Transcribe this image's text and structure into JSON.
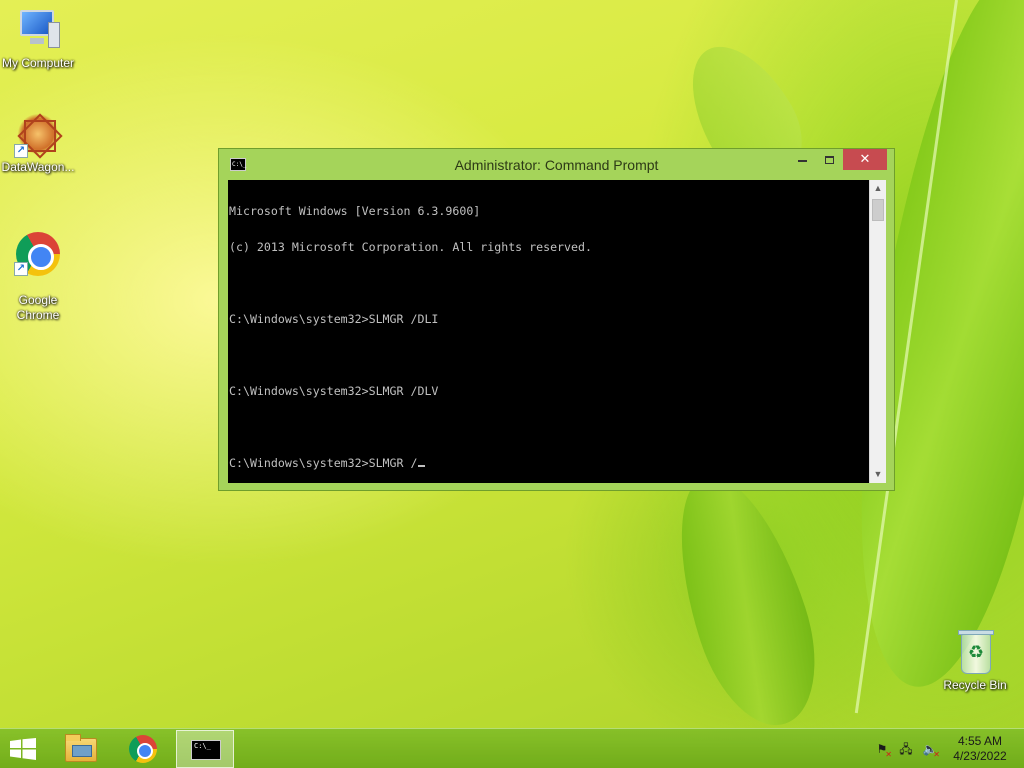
{
  "desktop": {
    "icons": [
      {
        "label": "My Computer",
        "icon": "computer-icon"
      },
      {
        "label": "DataWagon...",
        "icon": "datawagon-icon"
      },
      {
        "label": "Google\nChrome",
        "icon": "chrome-icon"
      },
      {
        "label": "Recycle Bin",
        "icon": "recycle-bin-icon"
      }
    ]
  },
  "window": {
    "title": "Administrator: Command Prompt",
    "close_glyph": "✕",
    "console_lines": [
      "Microsoft Windows [Version 6.3.9600]",
      "(c) 2013 Microsoft Corporation. All rights reserved.",
      "",
      "C:\\Windows\\system32>SLMGR /DLI",
      "",
      "C:\\Windows\\system32>SLMGR /DLV",
      "",
      "C:\\Windows\\system32>SLMGR /"
    ],
    "scroll_up_glyph": "▲",
    "scroll_down_glyph": "▼"
  },
  "taskbar": {
    "items": [
      {
        "name": "file-explorer",
        "icon": "folder-icon"
      },
      {
        "name": "google-chrome",
        "icon": "chrome-icon"
      },
      {
        "name": "command-prompt",
        "icon": "command-prompt-icon",
        "active": true
      }
    ],
    "tray": {
      "icons": [
        "action-center-flag-icon",
        "network-icon",
        "volume-muted-icon"
      ]
    },
    "clock": {
      "time": "4:55 AM",
      "date": "4/23/2022"
    }
  },
  "colors": {
    "accent_green": "#a5d45a",
    "close_red": "#c74b50",
    "console_bg": "#000000",
    "console_text": "#c0c0c0"
  }
}
